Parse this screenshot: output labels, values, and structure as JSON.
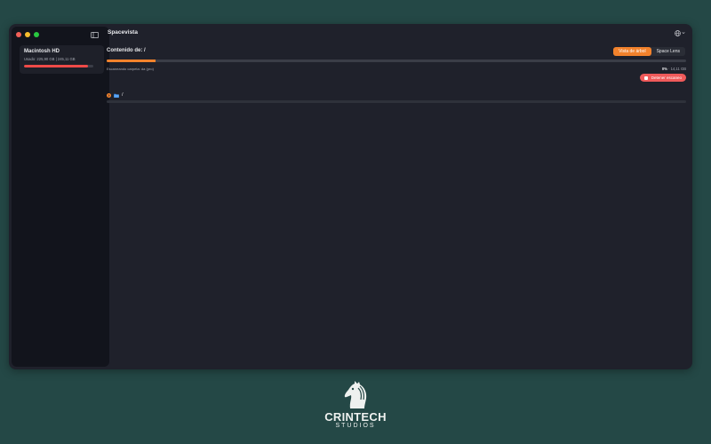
{
  "window": {
    "title": "Spacevista"
  },
  "sidebar": {
    "disk": {
      "name": "Macintosh HD",
      "used": "Usado: 225,90 GB | 245,11 GB",
      "used_fraction": 0.92
    }
  },
  "main": {
    "content_label": "Contenido de: /",
    "view_tabs": [
      {
        "label": "Vista de árbol",
        "active": true
      },
      {
        "label": "Space Lens",
        "active": false
      }
    ],
    "progress_fraction": 0.085,
    "scan_status": "Escaneando carpeta: da (pro)",
    "percent": "0%",
    "size": "14,11 GB",
    "stop_button": "Detener escaneo",
    "tree": {
      "root_name": "/"
    }
  },
  "branding": {
    "name": "CRINTECH",
    "sub": "STUDIOS"
  },
  "colors": {
    "accent": "#f2822c",
    "danger": "#ef5a5a",
    "background": "#244846",
    "window": "#1f212b",
    "sidebar": "#12141c"
  },
  "icons": [
    "sidebar-toggle-icon",
    "globe-icon",
    "chevron-down-icon",
    "stop-icon",
    "chevron-right-icon",
    "folder-icon",
    "horse-logo-icon"
  ]
}
